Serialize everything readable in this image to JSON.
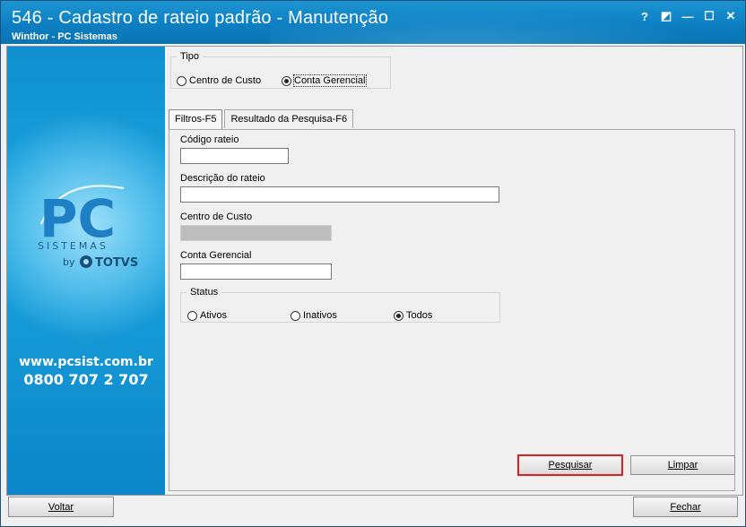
{
  "window": {
    "title": "546 - Cadastro de rateio padrão - Manutenção",
    "subtitle": "Winthor - PC Sistemas",
    "controls": [
      "?",
      "◩",
      "—",
      "☐",
      "✕"
    ]
  },
  "sidebar": {
    "logo_text": "PC",
    "logo_sub": "SISTEMAS",
    "by_text": "by",
    "brand": "TOTVS",
    "website": "www.pcsist.com.br",
    "phone": "0800 707 2 707"
  },
  "tipo": {
    "legend": "Tipo",
    "options": [
      {
        "label": "Centro de Custo",
        "checked": false
      },
      {
        "label": "Conta Gerencial",
        "checked": true
      }
    ]
  },
  "tabs": [
    {
      "label": "Filtros-F5",
      "active": true
    },
    {
      "label": "Resultado da Pesquisa-F6",
      "active": false
    }
  ],
  "filters": {
    "codigo_label": "Código rateio",
    "codigo_value": "",
    "descricao_label": "Descrição do rateio",
    "descricao_value": "",
    "centro_label": "Centro de Custo",
    "centro_value": "",
    "conta_label": "Conta Gerencial",
    "conta_value": ""
  },
  "status": {
    "legend": "Status",
    "options": [
      {
        "label": "Ativos",
        "checked": false
      },
      {
        "label": "Inativos",
        "checked": false
      },
      {
        "label": "Todos",
        "checked": true
      }
    ]
  },
  "buttons": {
    "pesquisar": "Pesquisar",
    "limpar": "Limpar",
    "voltar": "Voltar",
    "fechar": "Fechar"
  },
  "colors": {
    "title_bar": "#0c7fc2",
    "sidebar": "#1aa4df",
    "highlight": "#e02020"
  }
}
